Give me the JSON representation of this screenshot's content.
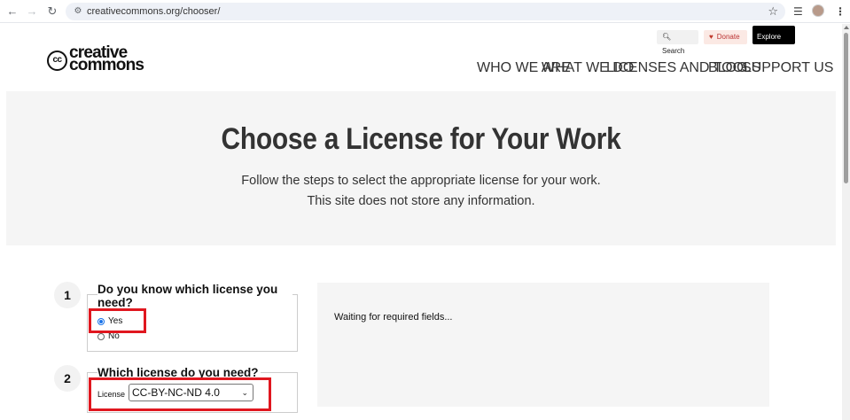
{
  "browser": {
    "url": "creativecommons.org/chooser/",
    "icons": {
      "back": "arrow-left-icon",
      "forward": "arrow-right-icon",
      "reload": "reload-icon",
      "site_info": "tune-icon",
      "bookmark": "star-icon",
      "media": "media-controls-icon",
      "menu": "kebab-menu-icon"
    }
  },
  "header": {
    "logo": {
      "line1": "creative",
      "line2": "commons",
      "badge": "cc"
    },
    "utility": {
      "search": "Search",
      "donate": "Donate",
      "explore": "Explore CC"
    },
    "nav": [
      "WHO WE ARE",
      "WHAT WE DO",
      "LICENSES AND TOOLS",
      "BLOG",
      "SUPPORT US"
    ]
  },
  "hero": {
    "title": "Choose a License for Your Work",
    "subtitle_line1": "Follow the steps to select the appropriate license for your work.",
    "subtitle_line2": "This site does not store any information."
  },
  "steps": [
    {
      "number": "1",
      "question": "Do you know which license you need?",
      "options": [
        {
          "label": "Yes",
          "checked": true
        },
        {
          "label": "No",
          "checked": false
        }
      ]
    },
    {
      "number": "2",
      "question": "Which license do you need?",
      "field_label": "License",
      "selected_value": "CC-BY-NC-ND 4.0"
    }
  ],
  "result": {
    "status_text": "Waiting for required fields..."
  },
  "colors": {
    "highlight": "#e0171f",
    "hero_bg": "#f5f5f5",
    "nav_text": "#666666",
    "explore_bg": "#000000",
    "donate_bg": "#fbe9e4"
  }
}
